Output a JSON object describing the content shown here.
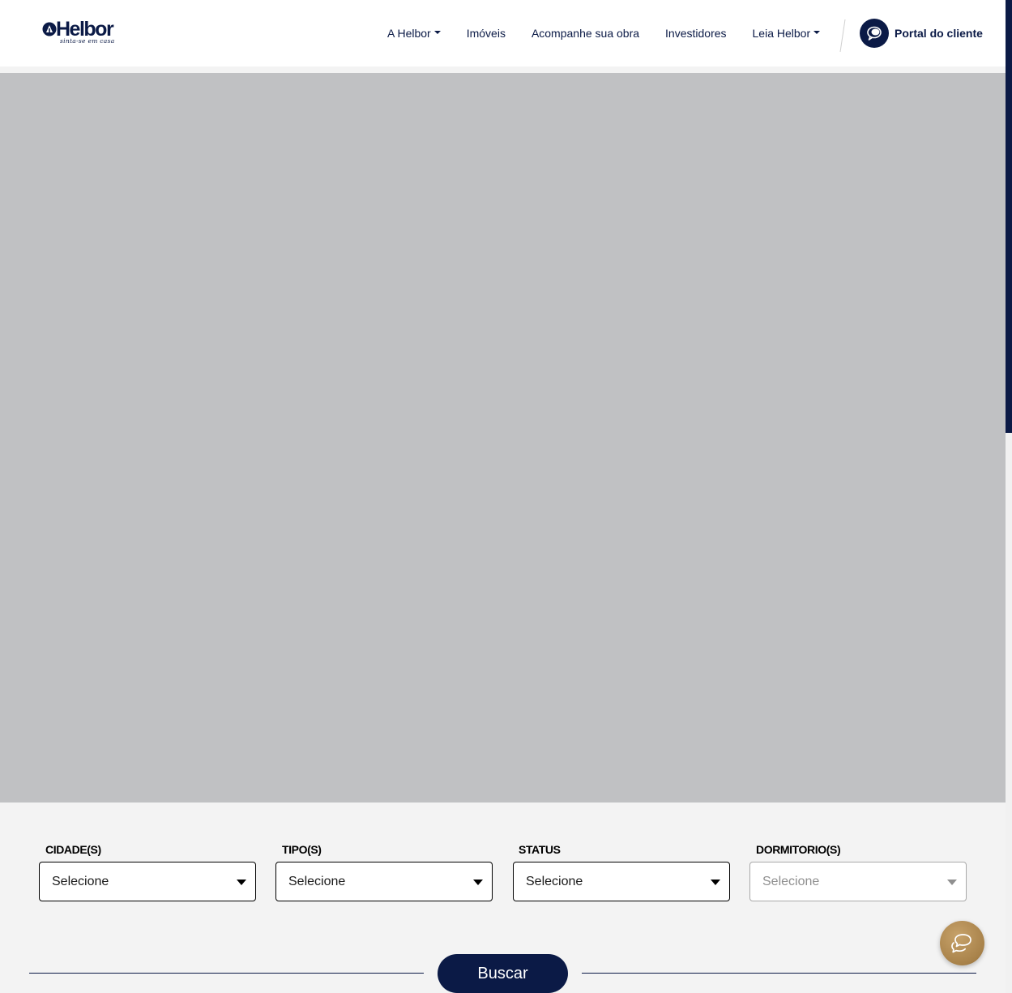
{
  "brand": {
    "name": "Helbor",
    "tagline": "sinta-se em casa",
    "color_primary": "#0b1a46",
    "color_accent": "#b08a52"
  },
  "nav": {
    "items": [
      {
        "label": "A Helbor",
        "dropdown": true
      },
      {
        "label": "Imóveis",
        "dropdown": false
      },
      {
        "label": "Acompanhe sua obra",
        "dropdown": false
      },
      {
        "label": "Investidores",
        "dropdown": false
      },
      {
        "label": "Leia Helbor",
        "dropdown": true
      }
    ],
    "portal_label": "Portal do cliente",
    "portal_icon": "chat-bubbles-icon"
  },
  "hero": {
    "background": "#c0c1c3"
  },
  "filters": [
    {
      "label": "CIDADE(S)",
      "value": "Selecione",
      "disabled": false
    },
    {
      "label": "TIPO(S)",
      "value": "Selecione",
      "disabled": false
    },
    {
      "label": "STATUS",
      "value": "Selecione",
      "disabled": false
    },
    {
      "label": "DORMITORIO(S)",
      "value": "Selecione",
      "disabled": true
    }
  ],
  "search_button": "Buscar",
  "chat_fab_icon": "chat-icon"
}
